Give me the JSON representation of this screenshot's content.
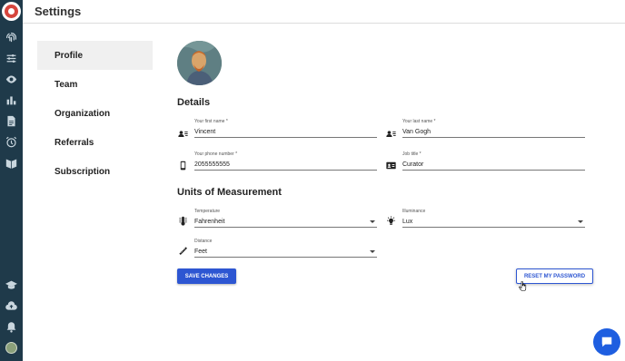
{
  "app": {
    "title": "Settings"
  },
  "rail": {
    "icons": [
      "logo-icon",
      "fingerprint-icon",
      "sliders-icon",
      "eye-icon",
      "bar-chart-icon",
      "report-icon",
      "alarm-icon",
      "book-icon",
      "graduation-cap-icon",
      "cloud-upload-icon",
      "bell-icon",
      "user-avatar"
    ]
  },
  "nav": {
    "items": [
      {
        "label": "Profile",
        "active": true
      },
      {
        "label": "Team"
      },
      {
        "label": "Organization"
      },
      {
        "label": "Referrals"
      },
      {
        "label": "Subscription"
      }
    ]
  },
  "details": {
    "title": "Details",
    "first_name": {
      "label": "Your first name *",
      "value": "Vincent"
    },
    "last_name": {
      "label": "Your last name *",
      "value": "Van Gogh"
    },
    "phone": {
      "label": "Your phone number *",
      "value": "2055555555"
    },
    "job_title": {
      "label": "Job title *",
      "value": "Curator"
    }
  },
  "units": {
    "title": "Units of Measurement",
    "temperature": {
      "label": "Temperature",
      "value": "Fahrenheit"
    },
    "illuminance": {
      "label": "Illuminance",
      "value": "Lux"
    },
    "distance": {
      "label": "Distance",
      "value": "Feet"
    }
  },
  "actions": {
    "save_label": "SAVE CHANGES",
    "reset_label": "RESET MY PASSWORD"
  },
  "colors": {
    "accent": "#2d56d2",
    "rail": "#1f3a4a",
    "chat": "#1e5ee0"
  }
}
